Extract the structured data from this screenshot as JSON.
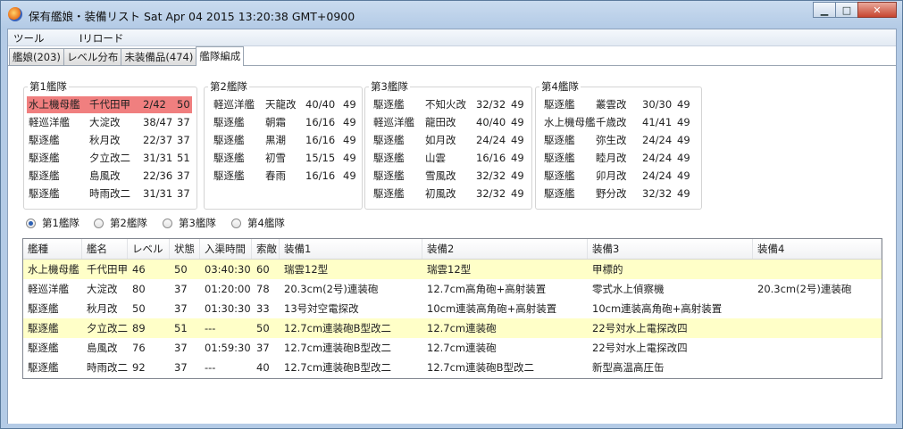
{
  "window": {
    "title": "保有艦娘・装備リスト Sat Apr 04 2015 13:20:38 GMT+0900",
    "buttons": {
      "minimize": "▁",
      "maximize": "□",
      "close": "✕"
    }
  },
  "menu": {
    "items": [
      "ツール",
      "Iリロード"
    ]
  },
  "tabs": [
    {
      "label": "艦娘(203)"
    },
    {
      "label": "レベル分布"
    },
    {
      "label": "未装備品(474)"
    },
    {
      "label": "艦隊編成",
      "active": true
    }
  ],
  "fleets": [
    {
      "title": "第1艦隊",
      "ships": [
        {
          "type": "水上機母艦",
          "name": "千代田甲",
          "hp": "2/42",
          "level": "50"
        },
        {
          "type": "軽巡洋艦",
          "name": "大淀改",
          "hp": "38/47",
          "level": "37"
        },
        {
          "type": "駆逐艦",
          "name": "秋月改",
          "hp": "22/37",
          "level": "37"
        },
        {
          "type": "駆逐艦",
          "name": "夕立改二",
          "hp": "31/31",
          "level": "51"
        },
        {
          "type": "駆逐艦",
          "name": "島風改",
          "hp": "22/36",
          "level": "37"
        },
        {
          "type": "駆逐艦",
          "name": "時雨改二",
          "hp": "31/31",
          "level": "37"
        }
      ]
    },
    {
      "title": "第2艦隊",
      "ships": [
        {
          "type": "軽巡洋艦",
          "name": "天龍改",
          "hp": "40/40",
          "level": "49"
        },
        {
          "type": "駆逐艦",
          "name": "朝霜",
          "hp": "16/16",
          "level": "49"
        },
        {
          "type": "駆逐艦",
          "name": "黒潮",
          "hp": "16/16",
          "level": "49"
        },
        {
          "type": "駆逐艦",
          "name": "初雪",
          "hp": "15/15",
          "level": "49"
        },
        {
          "type": "駆逐艦",
          "name": "春雨",
          "hp": "16/16",
          "level": "49"
        }
      ]
    },
    {
      "title": "第3艦隊",
      "ships": [
        {
          "type": "駆逐艦",
          "name": "不知火改",
          "hp": "32/32",
          "level": "49"
        },
        {
          "type": "軽巡洋艦",
          "name": "龍田改",
          "hp": "40/40",
          "level": "49"
        },
        {
          "type": "駆逐艦",
          "name": "如月改",
          "hp": "24/24",
          "level": "49"
        },
        {
          "type": "駆逐艦",
          "name": "山雲",
          "hp": "16/16",
          "level": "49"
        },
        {
          "type": "駆逐艦",
          "name": "雪風改",
          "hp": "32/32",
          "level": "49"
        },
        {
          "type": "駆逐艦",
          "name": "初風改",
          "hp": "32/32",
          "level": "49"
        }
      ]
    },
    {
      "title": "第4艦隊",
      "ships": [
        {
          "type": "駆逐艦",
          "name": "叢雲改",
          "hp": "30/30",
          "level": "49"
        },
        {
          "type": "水上機母艦",
          "name": "千歳改",
          "hp": "41/41",
          "level": "49"
        },
        {
          "type": "駆逐艦",
          "name": "弥生改",
          "hp": "24/24",
          "level": "49"
        },
        {
          "type": "駆逐艦",
          "name": "睦月改",
          "hp": "24/24",
          "level": "49"
        },
        {
          "type": "駆逐艦",
          "name": "卯月改",
          "hp": "24/24",
          "level": "49"
        },
        {
          "type": "駆逐艦",
          "name": "野分改",
          "hp": "32/32",
          "level": "49"
        }
      ]
    }
  ],
  "radio": {
    "options": [
      "第1艦隊",
      "第2艦隊",
      "第3艦隊",
      "第4艦隊"
    ],
    "selected": 0
  },
  "table": {
    "columns": [
      "艦種",
      "艦名",
      "レベル",
      "状態",
      "入渠時間",
      "索敵",
      "装備1",
      "装備2",
      "装備3",
      "装備4"
    ],
    "rows": [
      {
        "cells": [
          "水上機母艦",
          "千代田甲",
          "46",
          "50",
          "03:40:30",
          "60",
          "瑞雲12型",
          "瑞雲12型",
          "甲標的",
          ""
        ],
        "highlight": true
      },
      {
        "cells": [
          "軽巡洋艦",
          "大淀改",
          "80",
          "37",
          "01:20:00",
          "78",
          "20.3cm(2号)連装砲",
          "12.7cm高角砲+高射装置",
          "零式水上偵察機",
          "20.3cm(2号)連装砲"
        ],
        "highlight": false
      },
      {
        "cells": [
          "駆逐艦",
          "秋月改",
          "50",
          "37",
          "01:30:30",
          "33",
          "13号対空電探改",
          "10cm連装高角砲+高射装置",
          "10cm連装高角砲+高射装置",
          ""
        ],
        "highlight": false
      },
      {
        "cells": [
          "駆逐艦",
          "夕立改二",
          "89",
          "51",
          "---",
          "50",
          "12.7cm連装砲B型改二",
          "12.7cm連装砲",
          "22号対水上電探改四",
          ""
        ],
        "highlight": true
      },
      {
        "cells": [
          "駆逐艦",
          "島風改",
          "76",
          "37",
          "01:59:30",
          "37",
          "12.7cm連装砲B型改二",
          "12.7cm連装砲",
          "22号対水上電探改四",
          ""
        ],
        "highlight": false
      },
      {
        "cells": [
          "駆逐艦",
          "時雨改二",
          "92",
          "37",
          "---",
          "40",
          "12.7cm連装砲B型改二",
          "12.7cm連装砲B型改二",
          "新型高温高圧缶",
          ""
        ],
        "highlight": false
      }
    ]
  }
}
